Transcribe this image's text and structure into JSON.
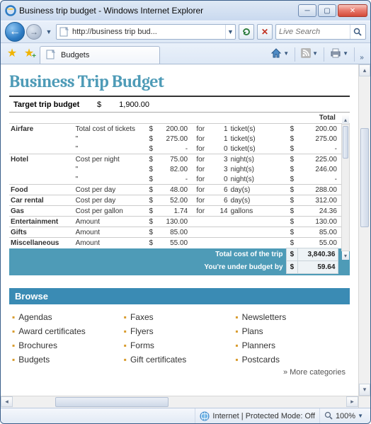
{
  "window": {
    "title": "Business trip budget - Windows Internet Explorer"
  },
  "address": {
    "url_display": "http://business trip bud..."
  },
  "search": {
    "placeholder": "Live Search"
  },
  "tab": {
    "label": "Budgets"
  },
  "document": {
    "title": "Business Trip Budget",
    "target_label": "Target trip budget",
    "target_currency": "$",
    "target_amount": "1,900.00",
    "total_header": "Total",
    "rows": [
      {
        "cat": "Airfare",
        "desc": "Total cost of tickets",
        "cur": "$",
        "amt": "200.00",
        "for": "for",
        "qty": "1",
        "unit": "ticket(s)",
        "tcur": "$",
        "tot": "200.00",
        "rule": true
      },
      {
        "cat": "",
        "desc": "\"",
        "cur": "$",
        "amt": "275.00",
        "for": "for",
        "qty": "1",
        "unit": "ticket(s)",
        "tcur": "$",
        "tot": "275.00"
      },
      {
        "cat": "",
        "desc": "\"",
        "cur": "$",
        "amt": "-",
        "for": "for",
        "qty": "0",
        "unit": "ticket(s)",
        "tcur": "$",
        "tot": "-"
      },
      {
        "cat": "Hotel",
        "desc": "Cost per night",
        "cur": "$",
        "amt": "75.00",
        "for": "for",
        "qty": "3",
        "unit": "night(s)",
        "tcur": "$",
        "tot": "225.00",
        "rule": true
      },
      {
        "cat": "",
        "desc": "\"",
        "cur": "$",
        "amt": "82.00",
        "for": "for",
        "qty": "3",
        "unit": "night(s)",
        "tcur": "$",
        "tot": "246.00"
      },
      {
        "cat": "",
        "desc": "\"",
        "cur": "$",
        "amt": "-",
        "for": "for",
        "qty": "0",
        "unit": "night(s)",
        "tcur": "$",
        "tot": "-"
      },
      {
        "cat": "Food",
        "desc": "Cost per day",
        "cur": "$",
        "amt": "48.00",
        "for": "for",
        "qty": "6",
        "unit": "day(s)",
        "tcur": "$",
        "tot": "288.00",
        "rule": true
      },
      {
        "cat": "Car rental",
        "desc": "Cost per day",
        "cur": "$",
        "amt": "52.00",
        "for": "for",
        "qty": "6",
        "unit": "day(s)",
        "tcur": "$",
        "tot": "312.00",
        "rule": true
      },
      {
        "cat": "Gas",
        "desc": "Cost per gallon",
        "cur": "$",
        "amt": "1.74",
        "for": "for",
        "qty": "14",
        "unit": "gallons",
        "tcur": "$",
        "tot": "24.36",
        "rule": true
      },
      {
        "cat": "Entertainment",
        "desc": "Amount",
        "cur": "$",
        "amt": "130.00",
        "for": "",
        "qty": "",
        "unit": "",
        "tcur": "$",
        "tot": "130.00",
        "rule": true
      },
      {
        "cat": "Gifts",
        "desc": "Amount",
        "cur": "$",
        "amt": "85.00",
        "for": "",
        "qty": "",
        "unit": "",
        "tcur": "$",
        "tot": "85.00",
        "rule": true
      },
      {
        "cat": "Miscellaneous",
        "desc": "Amount",
        "cur": "$",
        "amt": "55.00",
        "for": "",
        "qty": "",
        "unit": "",
        "tcur": "$",
        "tot": "55.00",
        "rule": true
      }
    ],
    "totals": {
      "cost_label": "Total cost of the trip",
      "cost_currency": "$",
      "cost_value": "3,840.36",
      "under_label": "You're under budget by",
      "under_currency": "$",
      "under_value": "59.64"
    }
  },
  "browse": {
    "header": "Browse",
    "columns": [
      [
        "Agendas",
        "Award certificates",
        "Brochures",
        "Budgets"
      ],
      [
        "Faxes",
        "Flyers",
        "Forms",
        "Gift certificates"
      ],
      [
        "Newsletters",
        "Plans",
        "Planners",
        "Postcards"
      ]
    ],
    "more": "» More categories"
  },
  "status": {
    "zone": "Internet | Protected Mode: Off",
    "zoom": "100%"
  }
}
